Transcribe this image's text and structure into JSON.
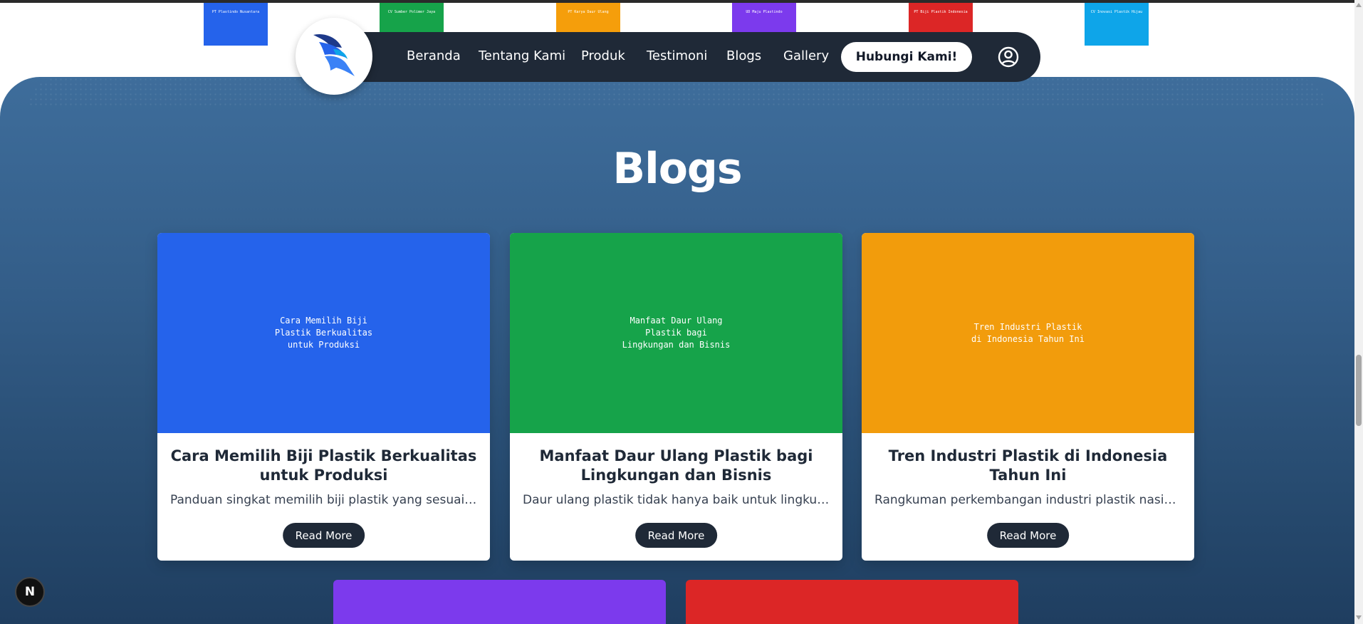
{
  "partners": [
    {
      "label": "PT Plastindo Nusantara",
      "color": "#2563eb"
    },
    {
      "label": "CV Sumber Polimer Jaya",
      "color": "#16a34a"
    },
    {
      "label": "PT Karya Daur Ulang",
      "color": "#f59e0b"
    },
    {
      "label": "UD Maju Plastindo",
      "color": "#7c3aed"
    },
    {
      "label": "PT Biji Plastik Indonesia",
      "color": "#dc2626"
    },
    {
      "label": "CV Inovasi Plastik Hijau",
      "color": "#0ea5e9"
    }
  ],
  "nav": {
    "links": [
      "Beranda",
      "Tentang Kami",
      "Produk",
      "Testimoni",
      "Blogs",
      "Gallery"
    ],
    "cta_label": "Hubungi Kami!",
    "user_icon": "user-circle-icon",
    "logo": "bird-logo-icon"
  },
  "section": {
    "heading": "Blogs"
  },
  "cards": [
    {
      "image_text": "Cara Memilih Biji\nPlastik Berkualitas\nuntuk Produksi",
      "image_color": "#2563eb",
      "title": "Cara Memilih Biji Plastik Berkualitas untuk Produksi",
      "description": "Panduan singkat memilih biji plastik yang sesuai kebutuhan produksi Anda",
      "button": "Read More"
    },
    {
      "image_text": "Manfaat Daur Ulang\nPlastik bagi\nLingkungan dan Bisnis",
      "image_color": "#16a34a",
      "title": "Manfaat Daur Ulang Plastik bagi Lingkungan dan Bisnis",
      "description": "Daur ulang plastik tidak hanya baik untuk lingkungan tetapi juga bisnis",
      "button": "Read More"
    },
    {
      "image_text": "Tren Industri Plastik\ndi Indonesia Tahun Ini",
      "image_color": "#f29c0c",
      "title": "Tren Industri Plastik di Indonesia Tahun Ini",
      "description": "Rangkuman perkembangan industri plastik nasional tahun ini",
      "button": "Read More"
    }
  ],
  "peek_cards": [
    {
      "color": "#7c3aed"
    },
    {
      "color": "#dc2626"
    }
  ],
  "badge": {
    "label": "N"
  }
}
